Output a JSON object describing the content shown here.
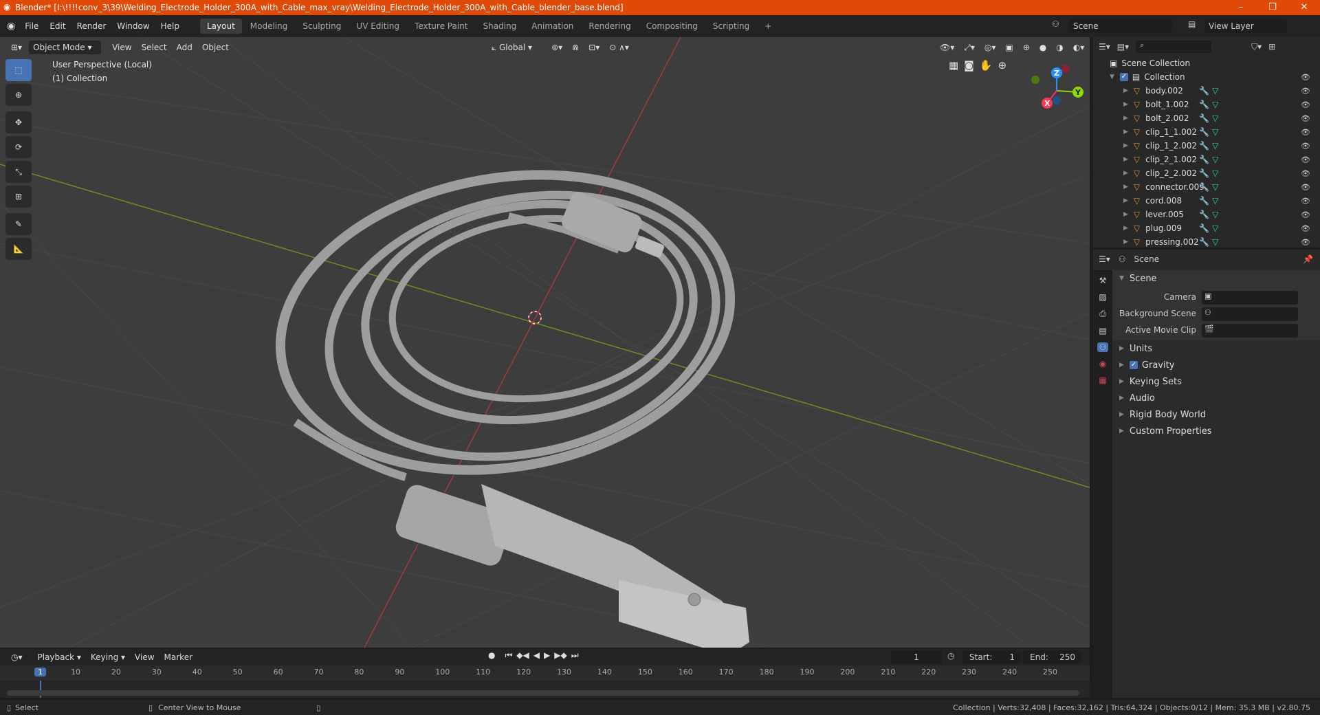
{
  "window": {
    "title": "Blender* [I:\\!!!!conv_3\\39\\Welding_Electrode_Holder_300A_with_Cable_max_vray\\Welding_Electrode_Holder_300A_with_Cable_blender_base.blend]",
    "minimize": "–",
    "maximize": "❐",
    "close": "✕"
  },
  "menu": [
    "File",
    "Edit",
    "Render",
    "Window",
    "Help"
  ],
  "workspaces": [
    "Layout",
    "Modeling",
    "Sculpting",
    "UV Editing",
    "Texture Paint",
    "Shading",
    "Animation",
    "Rendering",
    "Compositing",
    "Scripting"
  ],
  "active_workspace": "Layout",
  "scene_name": "Scene",
  "view_layer": "View Layer",
  "viewport": {
    "mode": "Object Mode",
    "menus": [
      "View",
      "Select",
      "Add",
      "Object"
    ],
    "transform": "Global",
    "overlay_title": "User Perspective (Local)",
    "overlay_collection": "(1) Collection",
    "axis_x": "X",
    "axis_y": "Y",
    "axis_z": "Z"
  },
  "outliner": {
    "root": "Scene Collection",
    "collection": "Collection",
    "objects": [
      "body.002",
      "bolt_1.002",
      "bolt_2.002",
      "clip_1_1.002",
      "clip_1_2.002",
      "clip_2_1.002",
      "clip_2_2.002",
      "connector.009",
      "cord.008",
      "lever.005",
      "plug.009",
      "pressing.002"
    ]
  },
  "properties": {
    "header": "Scene",
    "panel": "Scene",
    "camera_label": "Camera",
    "background_label": "Background Scene",
    "movie_label": "Active Movie Clip",
    "sections": [
      "Units",
      "Gravity",
      "Keying Sets",
      "Audio",
      "Rigid Body World",
      "Custom Properties"
    ]
  },
  "timeline": {
    "menus": [
      "Playback",
      "Keying",
      "View",
      "Marker"
    ],
    "current_frame": "1",
    "start_label": "Start:",
    "start": "1",
    "end_label": "End:",
    "end": "250",
    "ticks": [
      "1",
      "10",
      "20",
      "30",
      "40",
      "50",
      "60",
      "70",
      "80",
      "90",
      "100",
      "110",
      "120",
      "130",
      "140",
      "150",
      "160",
      "170",
      "180",
      "190",
      "200",
      "210",
      "220",
      "230",
      "240",
      "250"
    ]
  },
  "status": {
    "select": "Select",
    "center": "Center View to Mouse",
    "stats": "Collection | Verts:32,408 | Faces:32,162 | Tris:64,324 | Objects:0/12 | Mem: 35.3 MB | v2.80.75"
  },
  "colors": {
    "title_bar": "#e14a06",
    "accent": "#4772b3",
    "x_axis": "#ff3352",
    "y_axis": "#8bdc00",
    "z_axis": "#2890ff"
  }
}
